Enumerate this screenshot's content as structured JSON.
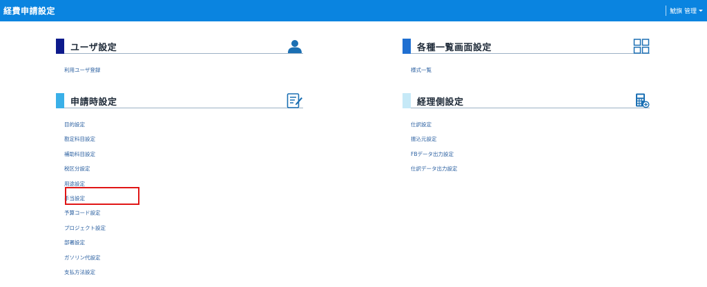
{
  "header": {
    "title": "経費申請設定",
    "user_label": "鯱旗 管理"
  },
  "colors": {
    "header_bg": "#0a84e0",
    "bar_user": "#0d1a8c",
    "bar_list": "#1f6fd1",
    "bar_apply": "#3ab0e8",
    "bar_accounting": "#c6e9f7",
    "icon": "#1a6fb3",
    "highlight": "#e01414"
  },
  "sections": {
    "user": {
      "title": "ユーザ設定",
      "icon": "person-icon",
      "items": [
        "利用ユーザ登録"
      ]
    },
    "list": {
      "title": "各種一覧画面設定",
      "icon": "grid-icon",
      "items": [
        "様式一覧"
      ]
    },
    "apply": {
      "title": "申請時設定",
      "icon": "edit-form-icon",
      "items": [
        "目的設定",
        "勘定科目設定",
        "補助科目設定",
        "税区分設定",
        "用途設定",
        "手当設定",
        "予算コード設定",
        "プロジェクト設定",
        "部署設定",
        "ガソリン代設定",
        "支払方法設定"
      ]
    },
    "accounting": {
      "title": "経理側設定",
      "icon": "calculator-icon",
      "items": [
        "仕訳設定",
        "振込元設定",
        "FBデータ出力設定",
        "仕訳データ出力設定"
      ]
    }
  },
  "highlight": {
    "target": "手当設定"
  }
}
